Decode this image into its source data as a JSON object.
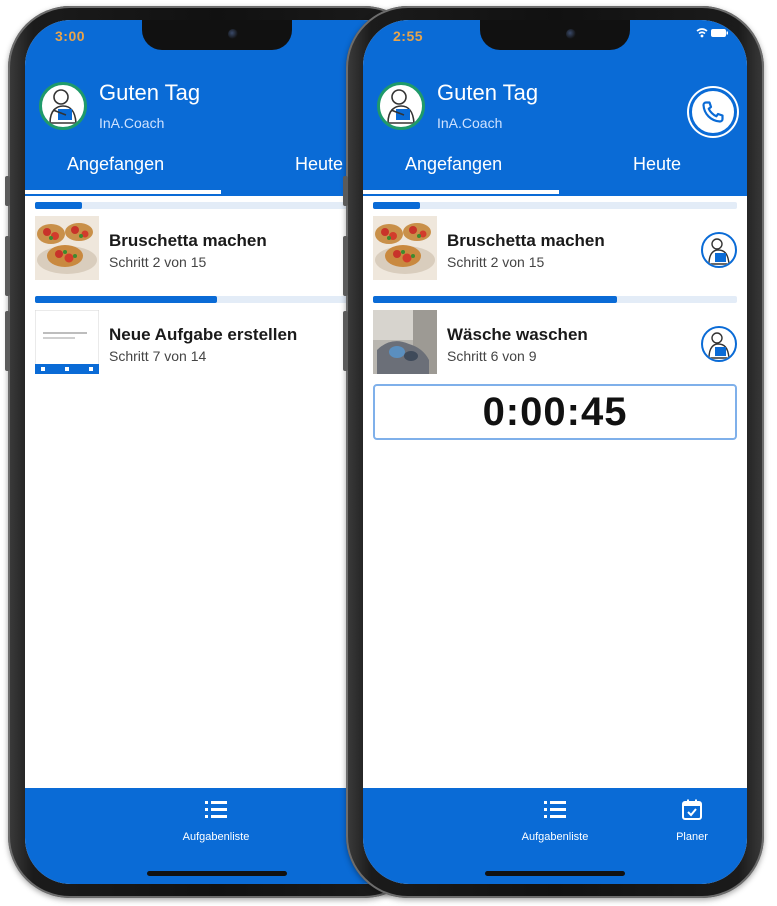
{
  "phones": [
    {
      "status_time": "3:00",
      "greeting": "Guten Tag",
      "brand": "InA.Coach",
      "tabs": [
        {
          "label": "Angefangen"
        },
        {
          "label": "Heute"
        }
      ],
      "tasks": [
        {
          "title": "Bruschetta machen",
          "subtitle": "Schritt 2 von 15",
          "progress": 0.13,
          "thumb": "bruschetta"
        },
        {
          "title": "Neue Aufgabe erstellen",
          "subtitle": "Schritt 7 von 14",
          "progress": 0.5,
          "thumb": "document"
        }
      ],
      "nav": [
        {
          "label": "Aufgabenliste",
          "icon": "list-icon"
        }
      ]
    },
    {
      "status_time": "2:55",
      "status_icons": "wifi-battery",
      "greeting": "Guten Tag",
      "brand": "InA.Coach",
      "tabs": [
        {
          "label": "Angefangen"
        },
        {
          "label": "Heute"
        }
      ],
      "tasks": [
        {
          "title": "Bruschetta machen",
          "subtitle": "Schritt 2 von 15",
          "progress": 0.13,
          "thumb": "bruschetta"
        },
        {
          "title": "Wäsche waschen",
          "subtitle": "Schritt 6 von 9",
          "progress": 0.67,
          "thumb": "laundry"
        }
      ],
      "timer": "0:00:45",
      "nav": [
        {
          "label": "Aufgabenliste",
          "icon": "list-icon"
        },
        {
          "label": "Planer",
          "icon": "calendar-icon"
        }
      ]
    }
  ],
  "colors": {
    "primary": "#0a6bd6",
    "progress_track": "#e3ecf7",
    "avatar_ring": "#1f9a6a",
    "status_time": "#e9a44a"
  }
}
